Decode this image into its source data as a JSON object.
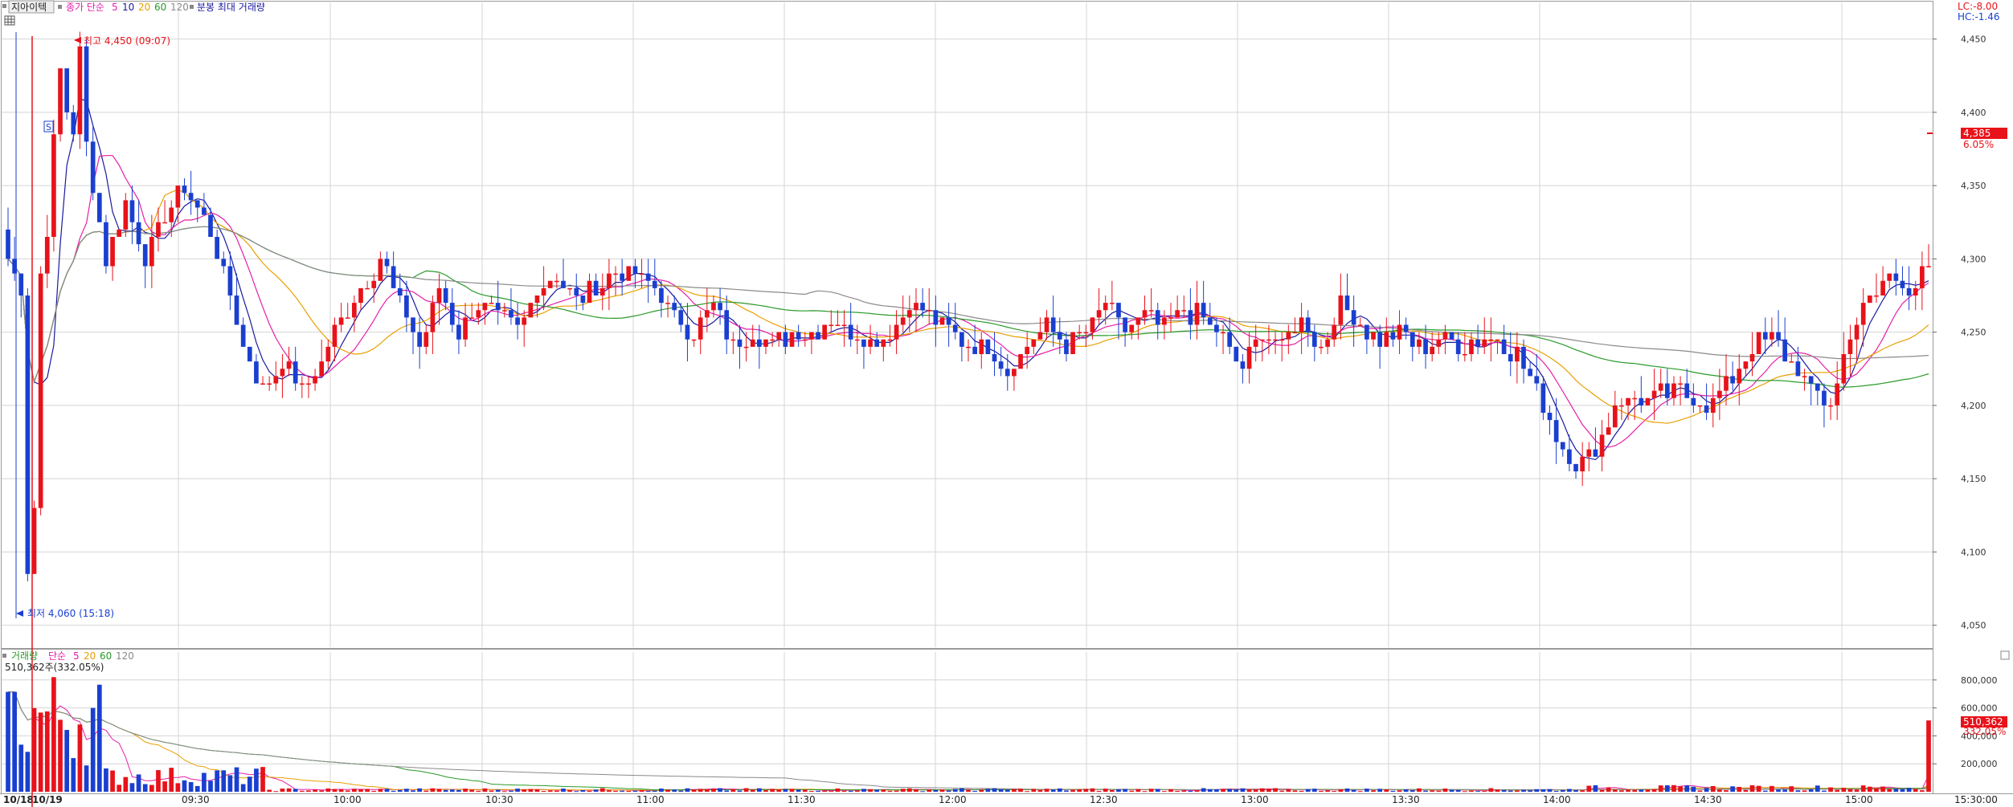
{
  "header": {
    "symbol": "지아이텍",
    "legend_prefix": "종가 단순",
    "ma_periods": [
      "5",
      "10",
      "20",
      "60",
      "120"
    ],
    "max_volume_label": "분봉 최대 거래량"
  },
  "right_info": {
    "lc": "LC:-8.00",
    "hc": "HC:-1.46"
  },
  "current_price": {
    "price": "4,385",
    "pct": "6.05%"
  },
  "annotations": {
    "high": "최고 4,450 (09:07)",
    "low": "최저 4,060 (15:18)",
    "s_marker": "S"
  },
  "volume_header": {
    "title": "거래량",
    "legend_prefix": "단순",
    "ma_periods": [
      "5",
      "20",
      "60",
      "120"
    ],
    "last_value": "510,362주(332.05%)"
  },
  "current_volume": {
    "value": "510,362",
    "pct": "332.05%"
  },
  "colors": {
    "up": "#e8121a",
    "down": "#1a3fd0",
    "ma5": "#1a1aa0",
    "ma10": "#e61ea8",
    "ma20": "#e8a000",
    "ma60": "#2a9a2a",
    "ma120": "#8a8a8a",
    "grid": "#d4d4d4",
    "high_line": "#e8121a"
  },
  "chart_data": [
    {
      "type": "candlestick",
      "title": "지아이텍",
      "y_ticks": [
        4050,
        4100,
        4150,
        4200,
        4250,
        4300,
        4350,
        4400,
        4450
      ],
      "y_tick_labels": [
        "4,050",
        "4,100",
        "4,150",
        "4,200",
        "4,250",
        "4,300",
        "4,350",
        "4,400",
        "4,450"
      ],
      "ylim": [
        4035,
        4475
      ],
      "x_tick_labels": [
        "10/18",
        "10/19",
        "09:30",
        "10:00",
        "10:30",
        "11:00",
        "11:30",
        "12:00",
        "12:30",
        "13:00",
        "13:30",
        "14:00",
        "14:30",
        "15:00",
        "15:30:00"
      ],
      "anchors": [
        [
          0,
          4300
        ],
        [
          2,
          4280
        ],
        [
          3,
          4090
        ],
        [
          4,
          4130
        ],
        [
          5,
          4290
        ],
        [
          6,
          4320
        ],
        [
          7,
          4380
        ],
        [
          8,
          4430
        ],
        [
          9,
          4400
        ],
        [
          10,
          4390
        ],
        [
          11,
          4440
        ],
        [
          12,
          4380
        ],
        [
          15,
          4300
        ],
        [
          18,
          4340
        ],
        [
          21,
          4300
        ],
        [
          24,
          4330
        ],
        [
          27,
          4350
        ],
        [
          30,
          4330
        ],
        [
          33,
          4290
        ],
        [
          36,
          4240
        ],
        [
          39,
          4210
        ],
        [
          42,
          4230
        ],
        [
          45,
          4210
        ],
        [
          48,
          4230
        ],
        [
          51,
          4260
        ],
        [
          54,
          4280
        ],
        [
          57,
          4300
        ],
        [
          60,
          4270
        ],
        [
          63,
          4240
        ],
        [
          66,
          4280
        ],
        [
          69,
          4250
        ],
        [
          72,
          4270
        ],
        [
          75,
          4260
        ],
        [
          78,
          4250
        ],
        [
          81,
          4280
        ],
        [
          84,
          4290
        ],
        [
          87,
          4270
        ],
        [
          90,
          4280
        ],
        [
          93,
          4290
        ],
        [
          96,
          4290
        ],
        [
          99,
          4280
        ],
        [
          102,
          4260
        ],
        [
          105,
          4250
        ],
        [
          108,
          4270
        ],
        [
          111,
          4240
        ],
        [
          114,
          4250
        ],
        [
          117,
          4240
        ],
        [
          120,
          4250
        ],
        [
          123,
          4250
        ],
        [
          126,
          4260
        ],
        [
          129,
          4250
        ],
        [
          132,
          4245
        ],
        [
          135,
          4250
        ],
        [
          138,
          4270
        ],
        [
          141,
          4260
        ],
        [
          144,
          4250
        ],
        [
          147,
          4240
        ],
        [
          150,
          4240
        ],
        [
          153,
          4225
        ],
        [
          156,
          4240
        ],
        [
          159,
          4255
        ],
        [
          162,
          4240
        ],
        [
          165,
          4250
        ],
        [
          168,
          4270
        ],
        [
          171,
          4250
        ],
        [
          174,
          4260
        ],
        [
          177,
          4255
        ],
        [
          180,
          4265
        ],
        [
          183,
          4260
        ],
        [
          186,
          4245
        ],
        [
          189,
          4225
        ],
        [
          192,
          4250
        ],
        [
          195,
          4240
        ],
        [
          198,
          4260
        ],
        [
          201,
          4240
        ],
        [
          204,
          4270
        ],
        [
          207,
          4255
        ],
        [
          210,
          4245
        ],
        [
          213,
          4250
        ],
        [
          216,
          4240
        ],
        [
          219,
          4245
        ],
        [
          222,
          4240
        ],
        [
          225,
          4245
        ],
        [
          228,
          4245
        ],
        [
          231,
          4235
        ],
        [
          234,
          4210
        ],
        [
          237,
          4180
        ],
        [
          240,
          4160
        ],
        [
          243,
          4170
        ],
        [
          246,
          4200
        ],
        [
          249,
          4205
        ],
        [
          252,
          4205
        ],
        [
          255,
          4210
        ],
        [
          258,
          4205
        ],
        [
          261,
          4200
        ],
        [
          264,
          4220
        ],
        [
          267,
          4240
        ],
        [
          270,
          4245
        ],
        [
          273,
          4230
        ],
        [
          276,
          4210
        ],
        [
          279,
          4200
        ],
        [
          282,
          4250
        ],
        [
          285,
          4270
        ],
        [
          288,
          4290
        ],
        [
          291,
          4280
        ],
        [
          294,
          4290
        ]
      ],
      "volume_ylim": [
        0,
        1000000
      ],
      "volume_ticks": [
        200000,
        400000,
        600000,
        800000
      ],
      "volume_tick_labels": [
        "200,000",
        "400,000",
        "600,000",
        "800,000"
      ],
      "last_volume": 510362
    }
  ]
}
